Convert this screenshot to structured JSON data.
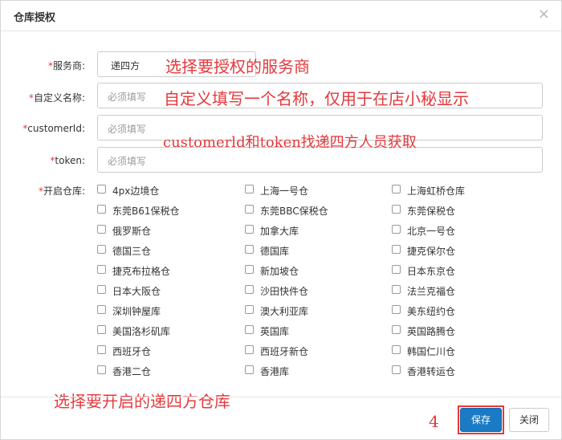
{
  "dialog": {
    "title": "仓库授权",
    "close_glyph": "×"
  },
  "fields": {
    "service": {
      "label": "服务商:",
      "value": "递四方"
    },
    "custom_name": {
      "label": "自定义名称:",
      "placeholder": "必须填写"
    },
    "customer_id": {
      "label": "customerId:",
      "placeholder": "必须填写"
    },
    "token": {
      "label": "token:",
      "placeholder": "必须填写"
    },
    "warehouses": {
      "label": "开启仓库:"
    },
    "required_mark": "*"
  },
  "warehouses": [
    "4px边境仓",
    "上海一号仓",
    "上海虹桥仓库",
    "东莞B61保税仓",
    "东莞BBC保税仓",
    "东莞保税仓",
    "俄罗斯仓",
    "加拿大库",
    "北京一号仓",
    "德国三仓",
    "德国库",
    "捷克保尔仓",
    "捷克布拉格仓",
    "新加坡仓",
    "日本东京仓",
    "日本大阪仓",
    "沙田快件仓",
    "法兰克福仓",
    "深圳钟屋库",
    "澳大利亚库",
    "美东纽约仓",
    "美国洛杉矶库",
    "英国库",
    "英国路腾仓",
    "西班牙仓",
    "西班牙新仓",
    "韩国仁川仓",
    "香港二仓",
    "香港库",
    "香港转运仓"
  ],
  "annotations": {
    "a1": "选择要授权的服务商",
    "a2": "自定义填写一个名称，仅用于在店小秘显示",
    "a3": "customerld和token找递四方人员获取",
    "a4": "选择要开启的递四方仓库",
    "a5": "4"
  },
  "footer": {
    "save_label": "保存",
    "close_label": "关闭"
  },
  "colors": {
    "primary": "#1a7bc4",
    "annotation_red": "#e4393c"
  }
}
